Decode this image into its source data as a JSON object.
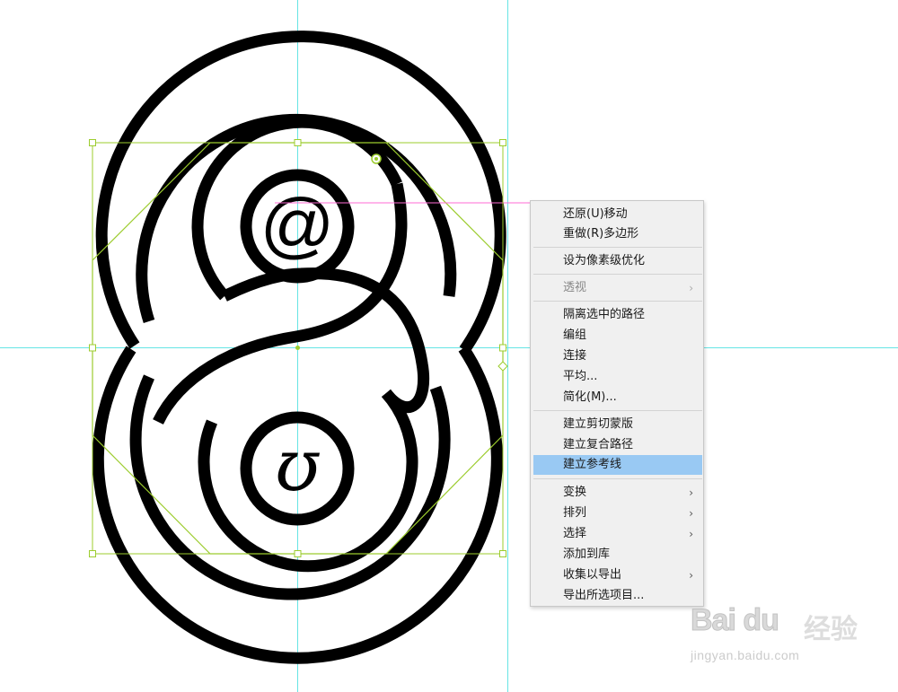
{
  "canvas": {
    "glyph_top": "@",
    "glyph_bottom": "ʊ",
    "colors": {
      "background": "#ffffff",
      "artwork": "#000000",
      "guide": "#66e5e5",
      "selection": "#9ccc2e",
      "smart_guide": "#ff6bd6",
      "menu_highlight": "#99c9f3"
    }
  },
  "context_menu": {
    "items": [
      {
        "label": "还原(U)移动",
        "disabled": false,
        "submenu": false
      },
      {
        "label": "重做(R)多边形",
        "disabled": false,
        "submenu": false
      },
      {
        "label": "设为像素级优化",
        "disabled": false,
        "submenu": false
      },
      {
        "label": "透视",
        "disabled": true,
        "submenu": true
      },
      {
        "label": "隔离选中的路径",
        "disabled": false,
        "submenu": false
      },
      {
        "label": "编组",
        "disabled": false,
        "submenu": false
      },
      {
        "label": "连接",
        "disabled": false,
        "submenu": false
      },
      {
        "label": "平均...",
        "disabled": false,
        "submenu": false
      },
      {
        "label": "简化(M)...",
        "disabled": false,
        "submenu": false
      },
      {
        "label": "建立剪切蒙版",
        "disabled": false,
        "submenu": false
      },
      {
        "label": "建立复合路径",
        "disabled": false,
        "submenu": false
      },
      {
        "label": "建立参考线",
        "disabled": false,
        "submenu": false,
        "highlighted": true
      },
      {
        "label": "变换",
        "disabled": false,
        "submenu": true
      },
      {
        "label": "排列",
        "disabled": false,
        "submenu": true
      },
      {
        "label": "选择",
        "disabled": false,
        "submenu": true
      },
      {
        "label": "添加到库",
        "disabled": false,
        "submenu": false
      },
      {
        "label": "收集以导出",
        "disabled": false,
        "submenu": true
      },
      {
        "label": "导出所选项目...",
        "disabled": false,
        "submenu": false
      }
    ],
    "submenu_arrow": "›"
  },
  "watermark": {
    "logo": "Bai du",
    "brand": "经验",
    "url": "jingyan.baidu.com"
  }
}
